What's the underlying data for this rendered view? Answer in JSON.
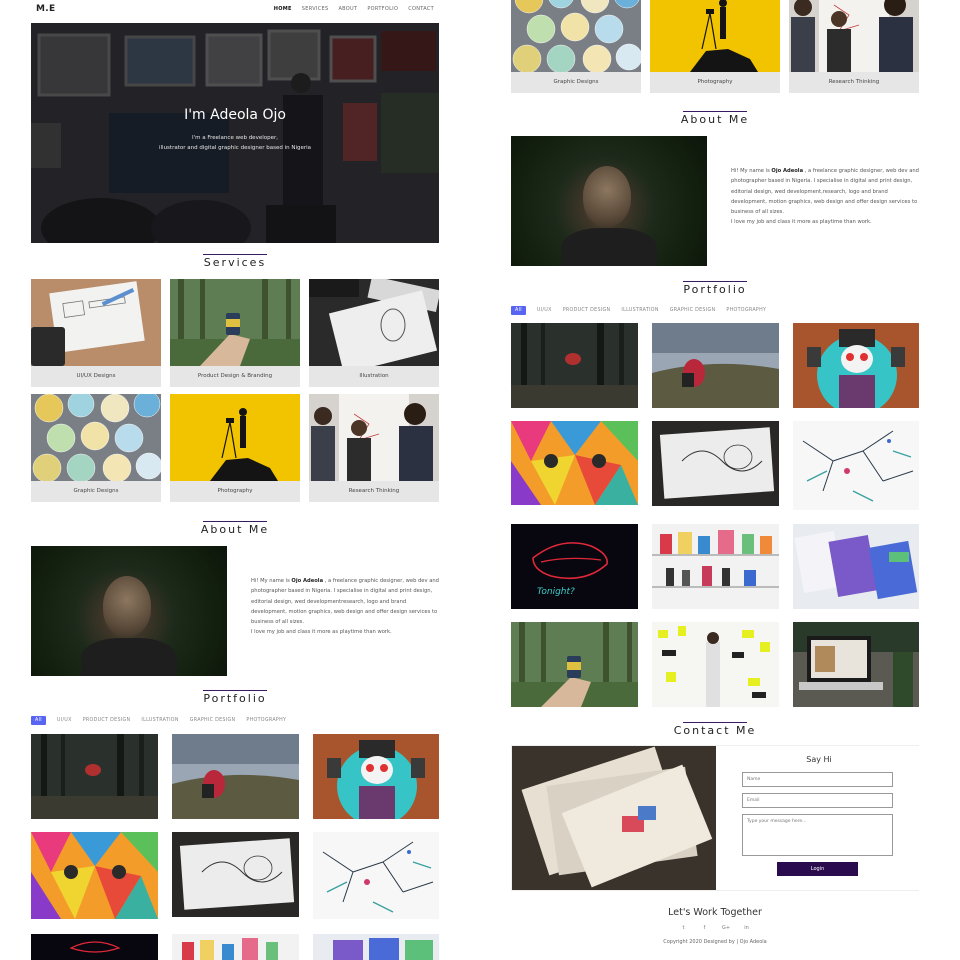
{
  "nav": {
    "logo": "M.E",
    "links": [
      "HOME",
      "SERVICES",
      "ABOUT",
      "PORTFOLIO",
      "CONTACT"
    ]
  },
  "hero": {
    "title": "I'm Adeola Ojo",
    "subtitle_line1": "I'm a Freelance web developer,",
    "subtitle_line2": "illustrator and digital graphic designer based in Nigeria"
  },
  "services": {
    "title": "Services",
    "cards": [
      {
        "label": "UI/UX Designs",
        "image": "wireframe-sketch-photo"
      },
      {
        "label": "Product Design & Branding",
        "image": "hand-holding-can-forest-photo"
      },
      {
        "label": "Illustration",
        "image": "sketchbook-keyboard-photo"
      },
      {
        "label": "Graphic Designs",
        "image": "button-badges-photo"
      },
      {
        "label": "Photography",
        "image": "photographer-silhouette-photo"
      },
      {
        "label": "Research Thinking",
        "image": "team-whiteboard-photo"
      }
    ]
  },
  "about": {
    "title": "About Me",
    "intro_prefix": "Hi! My name is ",
    "name": "Ojo Adeola",
    "left_text": " , a freelance graphic designer, web dev and photographer based in Nigeria. I specialise in digital and print design, editorial design, wed developmentresearch, logo and brand development, motion graphics, web design and offer design services to business of all sizes.",
    "right_text": " , a freelance graphic designer, web dev and photographer based in Nigeria. I specialise in digital and print design, editorial design, wed development,research, logo and brand development, motion graphics, web design and offer design services to business of all sizes.",
    "line2": "I love my job and class it more as playtime than work."
  },
  "portfolio": {
    "title": "Portfolio",
    "filters": [
      "All",
      "UI/UX",
      "PRODUCT DESIGN",
      "ILLUSTRATION",
      "GRAPHIC DESIGN",
      "PHOTOGRAPHY"
    ],
    "tiles": [
      "forest-person-photo",
      "hiker-hill-photo",
      "mural-girl-photo",
      "colorful-cat-mural-photo",
      "framed-sketch-photo",
      "ink-splatter-art-photo",
      "neon-lips-sign-photo",
      "shelf-products-photo",
      "stationery-mockup-photo",
      "hand-can-forest-photo",
      "pattern-wall-person-photo",
      "laptop-desk-photo"
    ],
    "neon_text": "Tonight?"
  },
  "contact": {
    "title": "Contact Me",
    "form_title": "Say Hi",
    "name_placeholder": "Name",
    "email_placeholder": "Email",
    "message_placeholder": "Type your message here...",
    "button_label": "Login"
  },
  "footer": {
    "title": "Let's Work Together",
    "socials": [
      "twitter-icon",
      "facebook-icon",
      "google-plus-icon",
      "linkedin-icon"
    ],
    "social_glyphs": [
      "t",
      "f",
      "G+",
      "in"
    ],
    "copyright": "Copyright 2020 Designed by | Ojo Adeola"
  },
  "colors": {
    "accent": "#5865f2",
    "button": "#2a0c4e",
    "title_bar": "#3a1a63"
  }
}
